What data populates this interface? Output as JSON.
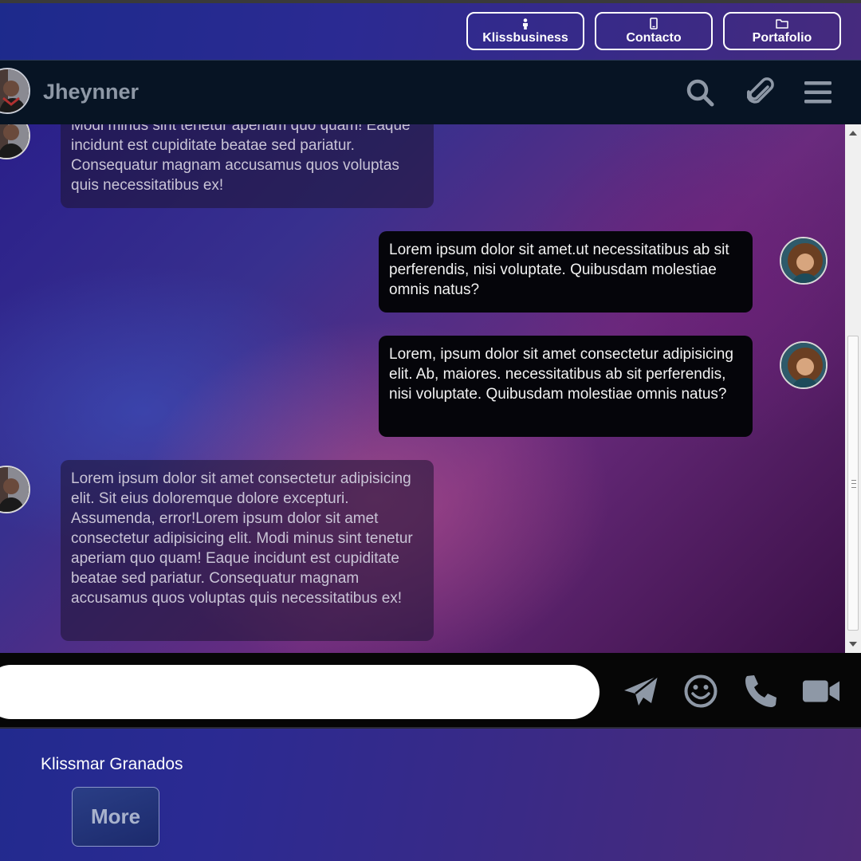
{
  "nav": {
    "buttons": [
      {
        "label": "Klissbusiness",
        "icon": "person-icon"
      },
      {
        "label": "Contacto",
        "icon": "phone-icon"
      },
      {
        "label": "Portafolio",
        "icon": "folder-icon"
      }
    ]
  },
  "header": {
    "name": "Jheynner",
    "icons": [
      "search-icon",
      "paperclip-icon",
      "menu-icon"
    ]
  },
  "messages": [
    {
      "side": "received",
      "text": "Modi minus sint tenetur aperiam quo quam! Eaque incidunt est cupiditate beatae sed pariatur. Consequatur magnam accusamus quos voluptas quis necessitatibus ex!"
    },
    {
      "side": "sent",
      "text": "Lorem ipsum dolor sit amet.ut necessitatibus ab sit perferendis, nisi voluptate. Quibusdam molestiae omnis natus?"
    },
    {
      "side": "sent",
      "text": "Lorem, ipsum dolor sit amet consectetur adipisicing elit. Ab, maiores. necessitatibus ab sit perferendis, nisi voluptate. Quibusdam molestiae omnis natus?"
    },
    {
      "side": "received",
      "text": "Lorem ipsum dolor sit amet consectetur adipisicing elit. Sit eius doloremque dolore excepturi. Assumenda, error!Lorem ipsum dolor sit amet consectetur adipisicing elit. Modi minus sint tenetur aperiam quo quam! Eaque incidunt est cupiditate beatae sed pariatur. Consequatur magnam accusamus quos voluptas quis necessitatibus ex!"
    }
  ],
  "composer": {
    "input_value": "",
    "icons": [
      "send-icon",
      "emoji-icon",
      "phone-call-icon",
      "video-camera-icon"
    ]
  },
  "footer": {
    "name": "Klissmar Granados",
    "more_label": "More"
  },
  "colors": {
    "header_bg": "#071424",
    "sent_bubble": "#05050a",
    "received_bubble": "#1e1432",
    "header_name": "#8e98a6"
  }
}
